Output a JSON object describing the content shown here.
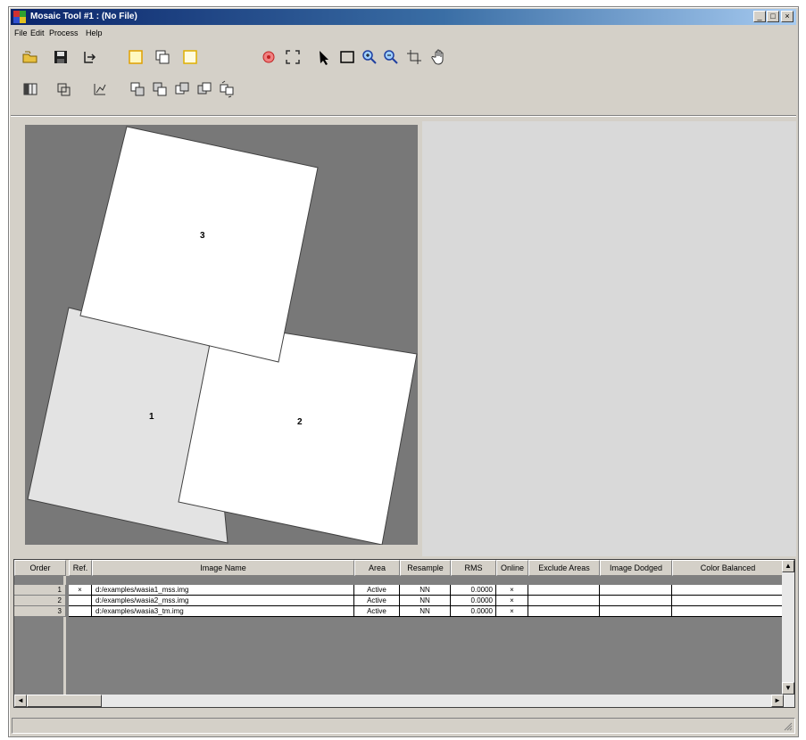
{
  "window": {
    "title": "Mosaic Tool #1 : (No File)",
    "controls": {
      "minimize": "_",
      "maximize": "□",
      "close": "×"
    }
  },
  "menu": [
    "File",
    "Edit",
    "Process",
    "Help"
  ],
  "toolbar1": [
    "open-folder-icon",
    "save-icon",
    "import-icon",
    "select-frame-icon",
    "copy-frame-icon",
    "blank-frame-icon",
    "compass-icon",
    "fit-extent-icon",
    "pointer-icon",
    "marquee-icon",
    "zoom-in-icon",
    "zoom-out-icon",
    "crop-icon",
    "pan-hand-icon"
  ],
  "toolbar2": [
    "grid-view-icon",
    "overlap-icon",
    "cutline-icon",
    "order-front-icon",
    "order-forward-icon",
    "order-backward-icon",
    "order-back-icon",
    "order-reverse-icon"
  ],
  "canvas": {
    "images": [
      {
        "label": "1",
        "fill": "#e3e3e3"
      },
      {
        "label": "2",
        "fill": "#ffffff"
      },
      {
        "label": "3",
        "fill": "#ffffff"
      }
    ],
    "background": "#787878"
  },
  "table": {
    "headers": [
      "Order",
      "Ref.",
      "Image Name",
      "Area",
      "Resample",
      "RMS",
      "Online",
      "Exclude Areas",
      "Image Dodged",
      "Color Balanced"
    ],
    "rows": [
      {
        "order": "1",
        "ref": "×",
        "name": "d:/examples/wasia1_mss.img",
        "area": "Active",
        "resample": "NN",
        "rms": "0.0000",
        "online": "×",
        "exclude": "",
        "dodged": "",
        "balanced": ""
      },
      {
        "order": "2",
        "ref": "",
        "name": "d:/examples/wasia2_mss.img",
        "area": "Active",
        "resample": "NN",
        "rms": "0.0000",
        "online": "×",
        "exclude": "",
        "dodged": "",
        "balanced": ""
      },
      {
        "order": "3",
        "ref": "",
        "name": "d:/examples/wasia3_tm.img",
        "area": "Active",
        "resample": "NN",
        "rms": "0.0000",
        "online": "×",
        "exclude": "",
        "dodged": "",
        "balanced": ""
      }
    ]
  },
  "scroll": {
    "up": "▲",
    "down": "▼",
    "left": "◄",
    "right": "►"
  },
  "statusbar": {
    "text": ""
  }
}
